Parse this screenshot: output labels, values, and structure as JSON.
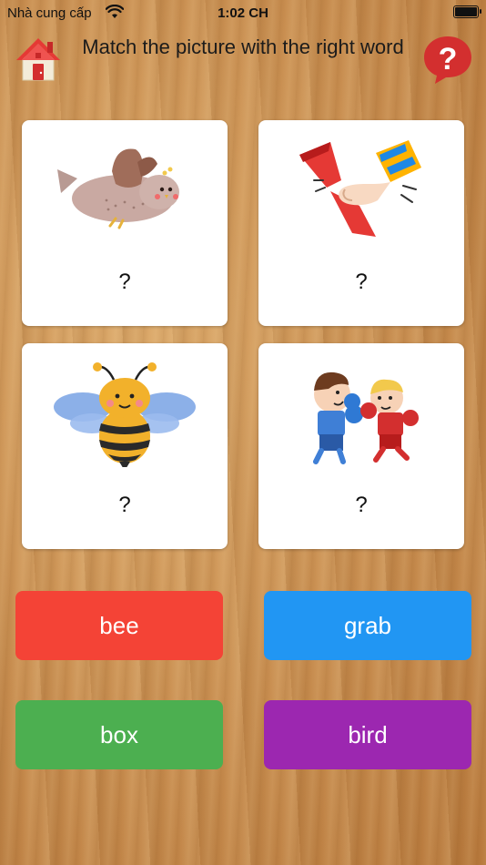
{
  "status_bar": {
    "carrier": "Nhà cung cấp",
    "time": "1:02 CH"
  },
  "header": {
    "title": "Match the picture with the right word",
    "home_icon": "house-icon",
    "help_icon": "question-bubble-icon"
  },
  "cards": [
    {
      "picture": "bird",
      "answer": "?"
    },
    {
      "picture": "grab",
      "answer": "?"
    },
    {
      "picture": "bee",
      "answer": "?"
    },
    {
      "picture": "box",
      "answer": "?"
    }
  ],
  "words": [
    {
      "label": "bee",
      "color": "#f44336"
    },
    {
      "label": "grab",
      "color": "#2196f3"
    },
    {
      "label": "box",
      "color": "#4caf50"
    },
    {
      "label": "bird",
      "color": "#9c27b0"
    }
  ]
}
